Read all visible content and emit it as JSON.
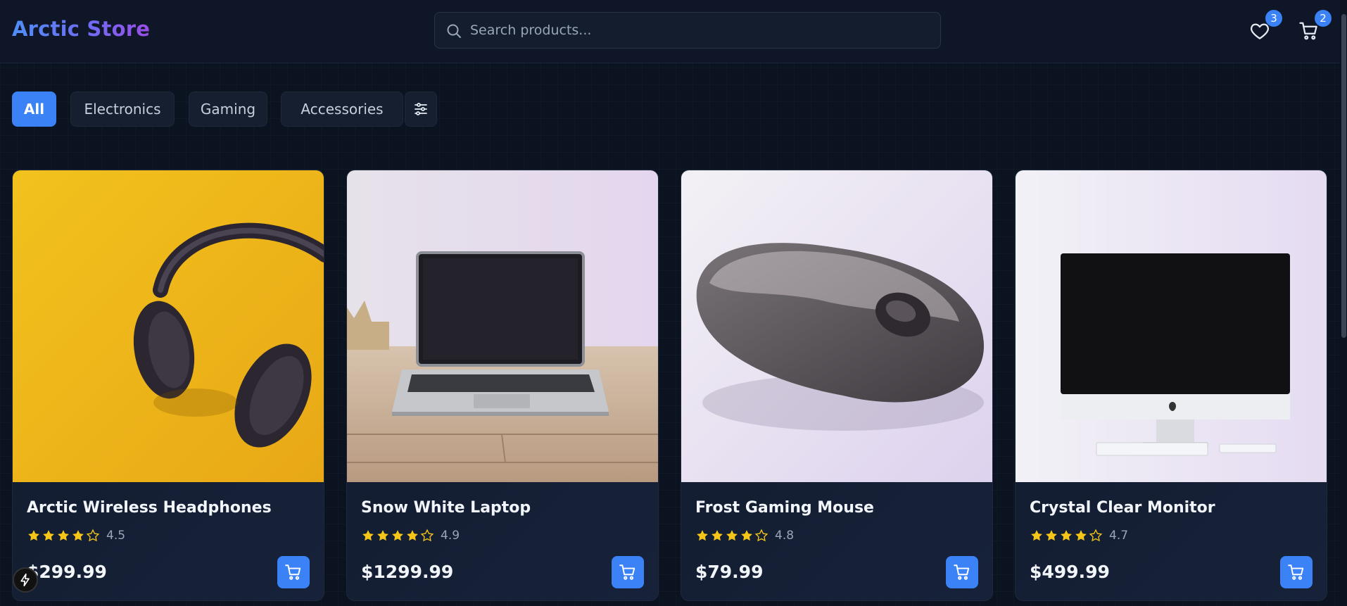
{
  "app": {
    "title": "Arctic Store",
    "accent": "#3b82f6"
  },
  "header": {
    "search_placeholder": "Search products...",
    "wishlist_count": "3",
    "cart_count": "2"
  },
  "filters": {
    "items": [
      {
        "label": "All",
        "active": true
      },
      {
        "label": "Electronics",
        "active": false
      },
      {
        "label": "Gaming",
        "active": false
      },
      {
        "label": "Accessories",
        "active": false
      }
    ],
    "settings_icon": "sliders-icon"
  },
  "products": [
    {
      "name": "Arctic Wireless Headphones",
      "rating": "4.5",
      "stars_filled": 4,
      "price": "$299.99",
      "image": "headphones"
    },
    {
      "name": "Snow White Laptop",
      "rating": "4.9",
      "stars_filled": 4,
      "price": "$1299.99",
      "image": "laptop"
    },
    {
      "name": "Frost Gaming Mouse",
      "rating": "4.8",
      "stars_filled": 4,
      "price": "$79.99",
      "image": "mouse"
    },
    {
      "name": "Crystal Clear Monitor",
      "rating": "4.7",
      "stars_filled": 4,
      "price": "$499.99",
      "image": "monitor"
    }
  ],
  "icons": {
    "search": "search-icon",
    "wishlist": "heart-icon",
    "cart": "shopping-cart-icon",
    "fab": "lightning-icon"
  }
}
